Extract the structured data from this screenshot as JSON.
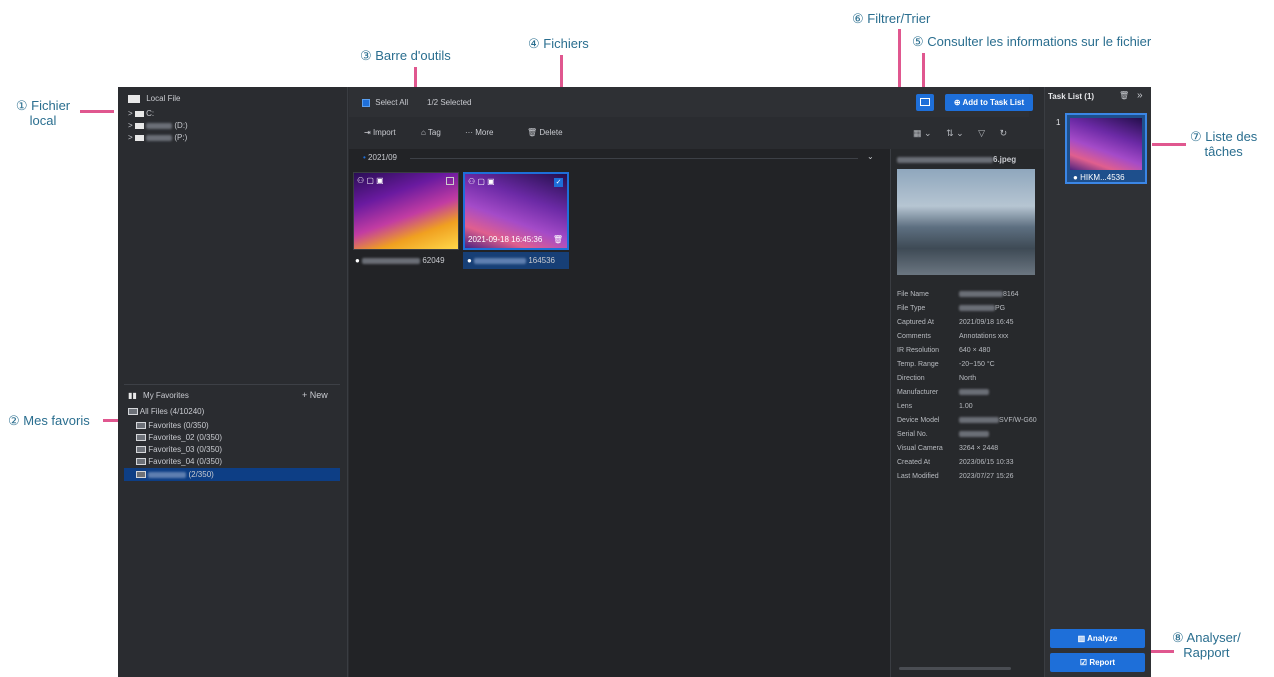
{
  "callouts": {
    "c1_num": "①",
    "c1a": "Fichier",
    "c1b": "local",
    "c2": "② Mes favoris",
    "c3": "③ Barre d'outils",
    "c4": "④ Fichiers",
    "c5": "⑤ Consulter les informations sur le fichier",
    "c6": "⑥ Filtrer/Trier",
    "c7a": "⑦ Liste des",
    "c7b": "tâches",
    "c8a": "⑧ Analyser/",
    "c8b": "Rapport"
  },
  "local_file": {
    "title": "Local File",
    "drives": [
      {
        "label": "C:"
      },
      {
        "label": "(D:)"
      },
      {
        "label": "(P:)"
      }
    ]
  },
  "favorites": {
    "title": "My Favorites",
    "new_label": "+ New",
    "items": [
      {
        "label": "All Files (4/10240)"
      },
      {
        "label": "Favorites (0/350)"
      },
      {
        "label": "Favorites_02 (0/350)"
      },
      {
        "label": "Favorites_03 (0/350)"
      },
      {
        "label": "Favorites_04 (0/350)"
      },
      {
        "label": "(2/350)"
      }
    ]
  },
  "topbar": {
    "select_all": "Select All",
    "selected": "1/2 Selected",
    "add_task": "Add to Task List"
  },
  "toolbar": {
    "import": "Import",
    "tag": "Tag",
    "more": "More",
    "delete": "Delete"
  },
  "files": {
    "group": "2021/09",
    "items": [
      {
        "name_tail": "62049"
      },
      {
        "name_tail": "164536",
        "timestamp": "2021-09-18 16:45:36"
      }
    ]
  },
  "info": {
    "filename_tail": "6.jpeg",
    "rows": [
      {
        "label": "File Name",
        "value": "8164"
      },
      {
        "label": "File Type",
        "value": "PG"
      },
      {
        "label": "Captured At",
        "value": "2021/09/18 16:45"
      },
      {
        "label": "Comments",
        "value": "Annotations xxx"
      },
      {
        "label": "IR Resolution",
        "value": "640 × 480"
      },
      {
        "label": "Temp. Range",
        "value": "-20~150 °C"
      },
      {
        "label": "Direction",
        "value": "North"
      },
      {
        "label": "Manufacturer",
        "value": ""
      },
      {
        "label": "Lens",
        "value": "1.00"
      },
      {
        "label": "Device Model",
        "value": "SVF/W-G60"
      },
      {
        "label": "Serial No.",
        "value": ""
      },
      {
        "label": "Visual Camera",
        "value": "3264 × 2448"
      },
      {
        "label": "Created At",
        "value": "2023/06/15 10:33"
      },
      {
        "label": "Last Modified",
        "value": "2023/07/27 15:26"
      }
    ]
  },
  "task_list": {
    "title": "Task List (1)",
    "index": "1",
    "item_label": "HIKM...4536",
    "analyze": "Analyze",
    "report": "Report"
  }
}
